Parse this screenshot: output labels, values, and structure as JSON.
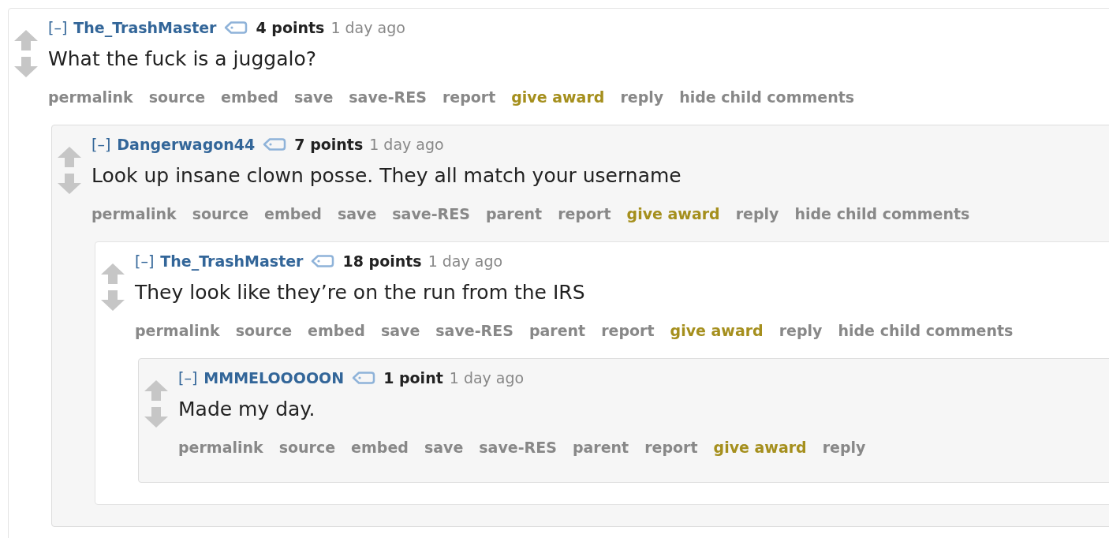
{
  "comments": [
    {
      "toggle": "[–]",
      "author": "The_TrashMaster",
      "score": "4 points",
      "time": "1 day ago",
      "body": "What the fuck is a juggalo?",
      "actions": [
        {
          "label": "permalink",
          "kind": "link"
        },
        {
          "label": "source",
          "kind": "link"
        },
        {
          "label": "embed",
          "kind": "link"
        },
        {
          "label": "save",
          "kind": "link"
        },
        {
          "label": "save-RES",
          "kind": "link"
        },
        {
          "label": "report",
          "kind": "link"
        },
        {
          "label": "give award",
          "kind": "award"
        },
        {
          "label": "reply",
          "kind": "link"
        },
        {
          "label": "hide child comments",
          "kind": "link"
        }
      ],
      "children": [
        {
          "toggle": "[–]",
          "author": "Dangerwagon44",
          "score": "7 points",
          "time": "1 day ago",
          "body": "Look up insane clown posse. They all match your username",
          "actions": [
            {
              "label": "permalink",
              "kind": "link"
            },
            {
              "label": "source",
              "kind": "link"
            },
            {
              "label": "embed",
              "kind": "link"
            },
            {
              "label": "save",
              "kind": "link"
            },
            {
              "label": "save-RES",
              "kind": "link"
            },
            {
              "label": "parent",
              "kind": "link"
            },
            {
              "label": "report",
              "kind": "link"
            },
            {
              "label": "give award",
              "kind": "award"
            },
            {
              "label": "reply",
              "kind": "link"
            },
            {
              "label": "hide child comments",
              "kind": "link"
            }
          ],
          "children": [
            {
              "toggle": "[–]",
              "author": "The_TrashMaster",
              "score": "18 points",
              "time": "1 day ago",
              "body": "They look like they’re on the run from the IRS",
              "actions": [
                {
                  "label": "permalink",
                  "kind": "link"
                },
                {
                  "label": "source",
                  "kind": "link"
                },
                {
                  "label": "embed",
                  "kind": "link"
                },
                {
                  "label": "save",
                  "kind": "link"
                },
                {
                  "label": "save-RES",
                  "kind": "link"
                },
                {
                  "label": "parent",
                  "kind": "link"
                },
                {
                  "label": "report",
                  "kind": "link"
                },
                {
                  "label": "give award",
                  "kind": "award"
                },
                {
                  "label": "reply",
                  "kind": "link"
                },
                {
                  "label": "hide child comments",
                  "kind": "link"
                }
              ],
              "children": [
                {
                  "toggle": "[–]",
                  "author": "MMMELOOOOON",
                  "score": "1 point",
                  "time": "1 day ago",
                  "body": "Made my day.",
                  "actions": [
                    {
                      "label": "permalink",
                      "kind": "link"
                    },
                    {
                      "label": "source",
                      "kind": "link"
                    },
                    {
                      "label": "embed",
                      "kind": "link"
                    },
                    {
                      "label": "save",
                      "kind": "link"
                    },
                    {
                      "label": "save-RES",
                      "kind": "link"
                    },
                    {
                      "label": "parent",
                      "kind": "link"
                    },
                    {
                      "label": "report",
                      "kind": "link"
                    },
                    {
                      "label": "give award",
                      "kind": "award"
                    },
                    {
                      "label": "reply",
                      "kind": "link"
                    }
                  ]
                }
              ]
            }
          ]
        }
      ]
    }
  ]
}
